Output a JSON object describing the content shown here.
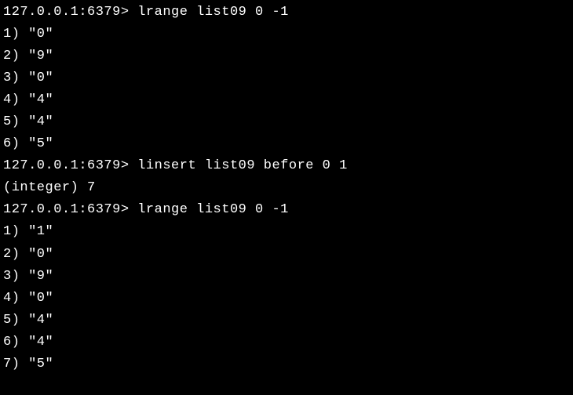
{
  "prompt": "127.0.0.1:6379> ",
  "commands": [
    {
      "input": "lrange list09 0 -1",
      "output": [
        "1) \"0\"",
        "2) \"9\"",
        "3) \"0\"",
        "4) \"4\"",
        "5) \"4\"",
        "6) \"5\""
      ]
    },
    {
      "input": "linsert list09 before 0 1",
      "output": [
        "(integer) 7"
      ]
    },
    {
      "input": "lrange list09 0 -1",
      "output": [
        "1) \"1\"",
        "2) \"0\"",
        "3) \"9\"",
        "4) \"0\"",
        "5) \"4\"",
        "6) \"4\"",
        "7) \"5\""
      ]
    }
  ]
}
